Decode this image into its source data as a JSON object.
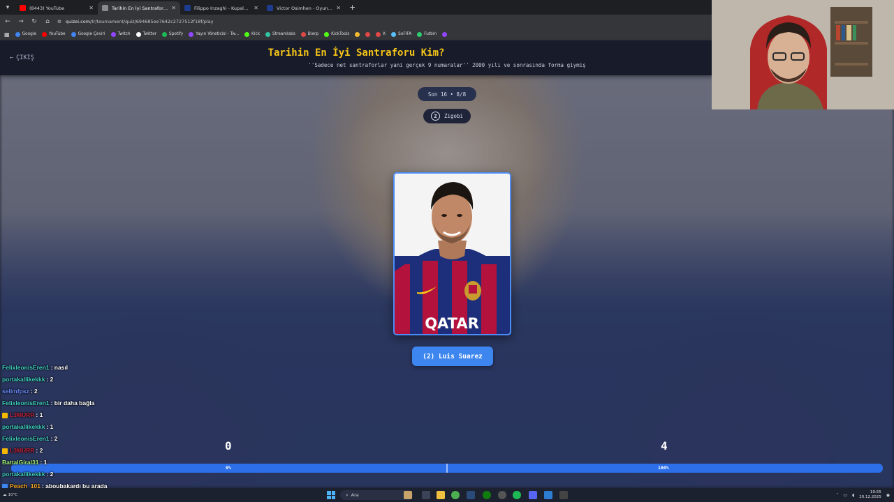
{
  "browser": {
    "tabs": [
      {
        "label": "(8443) YouTube",
        "favicon_color": "#ff0000",
        "active": false
      },
      {
        "label": "Tarihin En İyi Santraforu Kim? -",
        "favicon_color": "#8a8a8a",
        "active": true
      },
      {
        "label": "Filippo Inzaghi - Kupalar ve ba",
        "favicon_color": "#1d3c8f",
        "active": false
      },
      {
        "label": "Victor Osimhen - Oyuncu profi",
        "favicon_color": "#1d3c8f",
        "active": false
      }
    ],
    "url_host": "quizei.com",
    "url_path": "/tr/tournament/quiz/694685ee7642c2727512f18f/play",
    "bookmarks": [
      {
        "label": "Google",
        "color": "#4285f4"
      },
      {
        "label": "YouTube",
        "color": "#ff0000"
      },
      {
        "label": "Google Çeviri",
        "color": "#4285f4"
      },
      {
        "label": "Twitch",
        "color": "#9146ff"
      },
      {
        "label": "Twitter",
        "color": "#ffffff"
      },
      {
        "label": "Spotify",
        "color": "#1db954"
      },
      {
        "label": "Yayın Yöneticisi - Tw...",
        "color": "#9146ff"
      },
      {
        "label": "Kick",
        "color": "#53fc18"
      },
      {
        "label": "Streamlabs",
        "color": "#31c3a2"
      },
      {
        "label": "Bierp",
        "color": "#e04848"
      },
      {
        "label": "KickTools",
        "color": "#53fc18"
      },
      {
        "label": "",
        "color": "#f3ba2f"
      },
      {
        "label": "",
        "color": "#e04848"
      },
      {
        "label": "K",
        "color": "#e04848"
      },
      {
        "label": "SoFIFA",
        "color": "#58c0ff"
      },
      {
        "label": "Futbin",
        "color": "#2ecc71"
      },
      {
        "label": "",
        "color": "#9146ff"
      }
    ]
  },
  "quiz": {
    "back_label": "ÇIKIŞ",
    "title": "Tarihin En İyi Santraforu Kim?",
    "subtitle": "''Sadece net santraforlar yani gerçek 9 numaralar'' 2000 yılı ve sonrasında forma giymiş",
    "round_label": "Son 16 • 8/8",
    "user_label": "Zigobi",
    "choice_label": "(2) Luis Suarez",
    "score_left": "0",
    "score_right": "4",
    "pct_left": "0%",
    "pct_right": "100%",
    "progress_fill": 0.0
  },
  "chat": [
    {
      "user": "FelixleonisEren1",
      "user_color": "#3fd0c0",
      "msg": ": nasıl",
      "badge": ""
    },
    {
      "user": "portakallikekkk",
      "user_color": "#3fd0c0",
      "msg": ": 2",
      "badge": ""
    },
    {
      "user": "selimfpsz",
      "user_color": "#6a8cff",
      "msg": ": 2",
      "badge": ""
    },
    {
      "user": "FelixleonisEren1",
      "user_color": "#3fd0c0",
      "msg": ": bir daha bağla",
      "badge": ""
    },
    {
      "user": "L3MURR",
      "user_color": "#c0243c",
      "msg": ": 1",
      "badge": "#f5b800"
    },
    {
      "user": "portakallikekkk",
      "user_color": "#3fd0c0",
      "msg": ": 1",
      "badge": ""
    },
    {
      "user": "FelixleonisEren1",
      "user_color": "#3fd0c0",
      "msg": ": 2",
      "badge": ""
    },
    {
      "user": "L3MURR",
      "user_color": "#c0243c",
      "msg": ": 2",
      "badge": "#f5b800"
    },
    {
      "user": "BattalGiral31",
      "user_color": "#9ef07a",
      "msg": ": 1",
      "badge": ""
    },
    {
      "user": "portakallikekkk",
      "user_color": "#3fd0c0",
      "msg": ": 2",
      "badge": ""
    },
    {
      "user": "Peach_101",
      "user_color": "#f5a623",
      "msg": ": aboubakardı bu arada",
      "badge": "#3d86f0"
    },
    {
      "user": "BattalGiral31",
      "user_color": "#9ef07a",
      "msg": ": 2",
      "badge": ""
    }
  ],
  "taskbar": {
    "weather": "10°C",
    "search_label": "Ara",
    "time": "19:55",
    "date": "20.12.2025"
  }
}
